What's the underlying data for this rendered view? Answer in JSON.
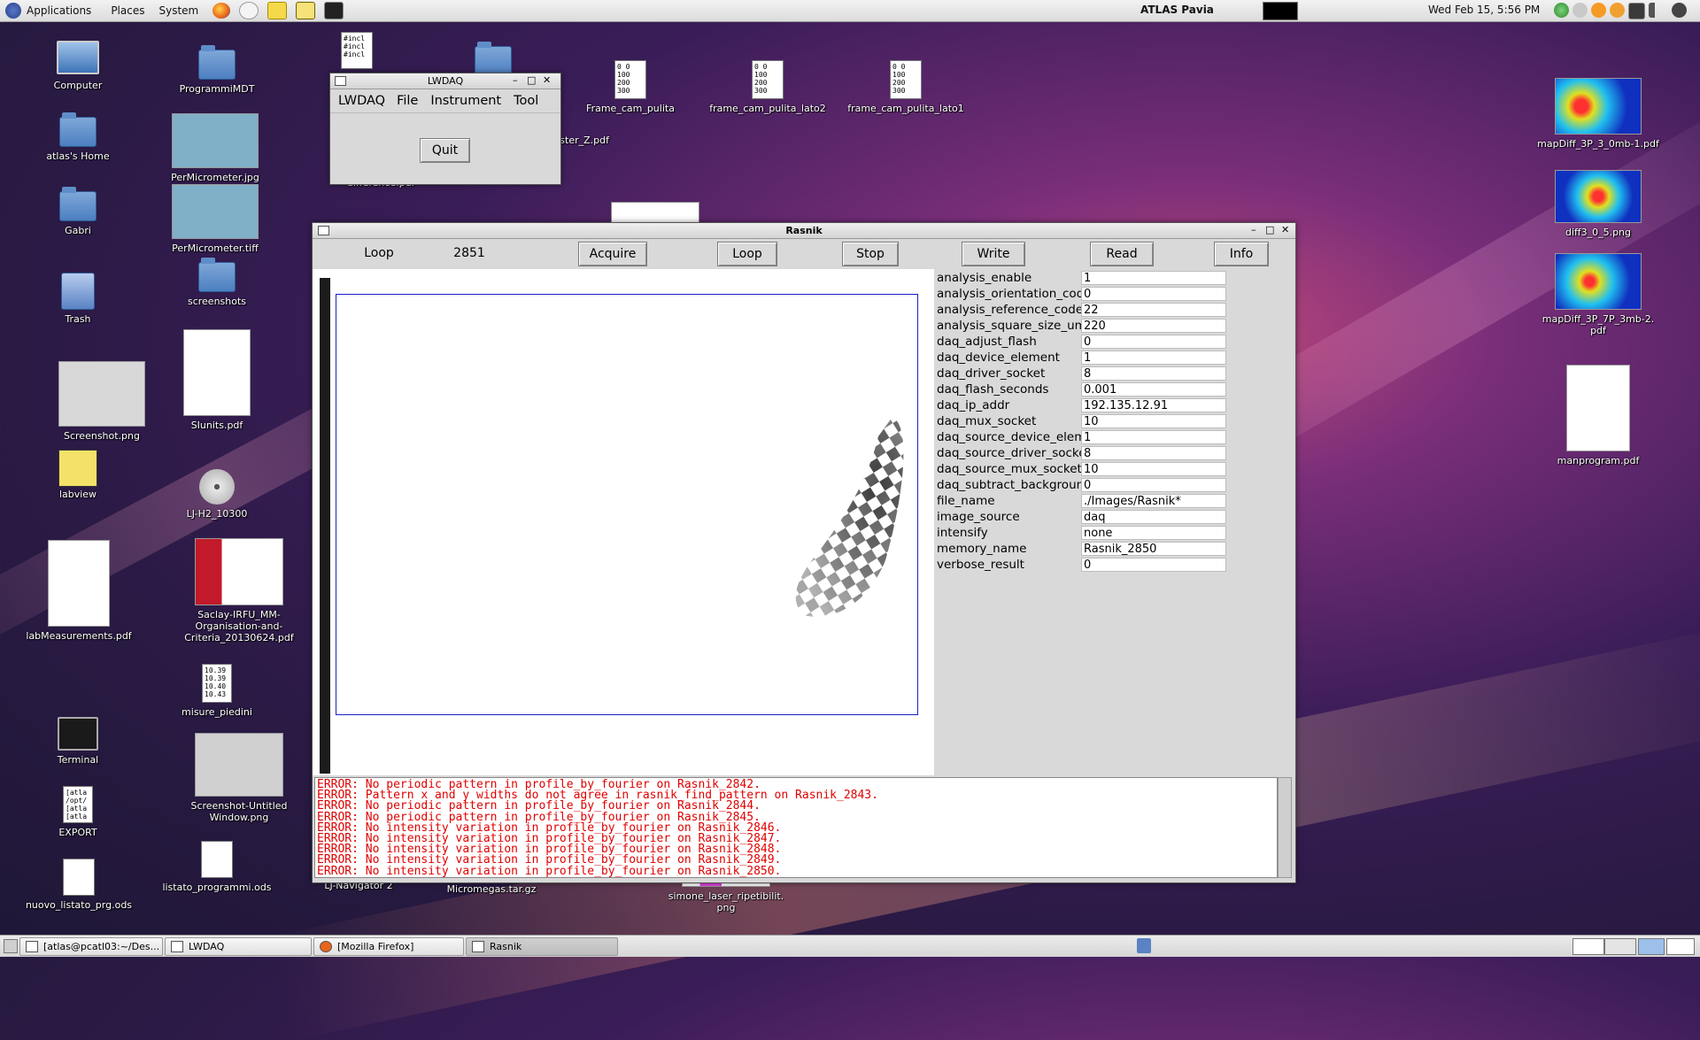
{
  "top_panel": {
    "menus": [
      "Applications",
      "Places",
      "System"
    ],
    "center_title": "ATLAS Pavia",
    "clock": "Wed Feb 15,  5:56 PM"
  },
  "desktop_icons": {
    "computer": "Computer",
    "home": "atlas's Home",
    "gabri": "Gabri",
    "trash": "Trash",
    "screenshot_png": "Screenshot.png",
    "labview": "labview",
    "labmeasurements": "labMeasurements.pdf",
    "terminal": "Terminal",
    "export": "EXPORT",
    "export_text": [
      "[atla",
      "/opt/",
      "[atla",
      "[atla"
    ],
    "nuovo_listato": "nuovo_listato_prg.ods",
    "programmimdt": "ProgrammiMDT",
    "permicrometer_jpg": "PerMicrometer.jpg",
    "permicrometer_tiff": "PerMicrometer.tiff",
    "screenshots": "screenshots",
    "slunits": "SIunits.pdf",
    "ljh2": "LJ-H2_10300",
    "saclay_lines": [
      "Saclay-IRFU_MM-",
      "Organisation-and-",
      "Criteria_20130624.pdf"
    ],
    "misure": "misure_piedini",
    "misure_text": [
      "10.39",
      "10.39",
      "10.40",
      "10.43"
    ],
    "screenshot_untitled_lines": [
      "Screenshot-Untitled",
      "Window.png"
    ],
    "listato_programmi": "listato_programmi.ods",
    "lj_navigator": "LJ-Navigator 2",
    "micromegas": "Micromegas.tar.gz",
    "simone_lines": [
      "simone_laser_ripetibilit.",
      "png"
    ],
    "incl_text": [
      "#incl",
      "#incl",
      "#incl"
    ],
    "frame_pulita": "Frame_cam_pulita",
    "frame_lato2": "frame_cam_pulita_lato2",
    "frame_lato1": "frame_cam_pulita_lato1",
    "frame_text": [
      "0  0",
      "100",
      "200",
      "300"
    ],
    "ster_z": "ster_Z.pdf",
    "difference_partial": "difference.pdf",
    "mapdiff1": "mapDiff_3P_3_0mb-1.pdf",
    "diff3": "diff3_0_5.png",
    "mapdiff2_lines": [
      "mapDiff_3P_7P_3mb-2.",
      "pdf"
    ],
    "manprogram": "manprogram.pdf"
  },
  "lwdaq_window": {
    "title": "LWDAQ",
    "menus": [
      "LWDAQ",
      "File",
      "Instrument",
      "Tool"
    ],
    "quit_label": "Quit"
  },
  "rasnik_window": {
    "title": "Rasnik",
    "toolbar": {
      "loop_label": "Loop",
      "counter": "2851",
      "acquire": "Acquire",
      "loop_button": "Loop",
      "stop": "Stop",
      "write": "Write",
      "read": "Read",
      "info": "Info"
    },
    "params": [
      {
        "name": "analysis_enable",
        "value": "1"
      },
      {
        "name": "analysis_orientation_code",
        "value": "0"
      },
      {
        "name": "analysis_reference_code",
        "value": "22"
      },
      {
        "name": "analysis_square_size_um",
        "value": "220"
      },
      {
        "name": "daq_adjust_flash",
        "value": "0"
      },
      {
        "name": "daq_device_element",
        "value": "1"
      },
      {
        "name": "daq_driver_socket",
        "value": "8"
      },
      {
        "name": "daq_flash_seconds",
        "value": "0.001"
      },
      {
        "name": "daq_ip_addr",
        "value": "192.135.12.91"
      },
      {
        "name": "daq_mux_socket",
        "value": "10"
      },
      {
        "name": "daq_source_device_element",
        "value": "1"
      },
      {
        "name": "daq_source_driver_socket",
        "value": "8"
      },
      {
        "name": "daq_source_mux_socket",
        "value": "10"
      },
      {
        "name": "daq_subtract_background",
        "value": "0"
      },
      {
        "name": "file_name",
        "value": "./Images/Rasnik*"
      },
      {
        "name": "image_source",
        "value": "daq"
      },
      {
        "name": "intensify",
        "value": "none"
      },
      {
        "name": "memory_name",
        "value": "Rasnik_2850"
      },
      {
        "name": "verbose_result",
        "value": "0"
      }
    ],
    "log": [
      "ERROR: No periodic pattern in profile_by_fourier on Rasnik_2842.",
      "ERROR: Pattern x and y widths do not agree in rasnik_find_pattern on Rasnik_2843.",
      "ERROR: No periodic pattern in profile_by_fourier on Rasnik_2844.",
      "ERROR: No periodic pattern in profile_by_fourier on Rasnik_2845.",
      "ERROR: No intensity variation in profile_by_fourier on Rasnik_2846.",
      "ERROR: No intensity variation in profile_by_fourier on Rasnik_2847.",
      "ERROR: No intensity variation in profile_by_fourier on Rasnik_2848.",
      "ERROR: No intensity variation in profile_by_fourier on Rasnik_2849.",
      "ERROR: No intensity variation in profile_by_fourier on Rasnik_2850."
    ]
  },
  "taskbar": [
    {
      "label": "[atlas@pcatl03:~/Des..."
    },
    {
      "label": "LWDAQ"
    },
    {
      "label": "[Mozilla Firefox]"
    },
    {
      "label": "Rasnik"
    }
  ]
}
